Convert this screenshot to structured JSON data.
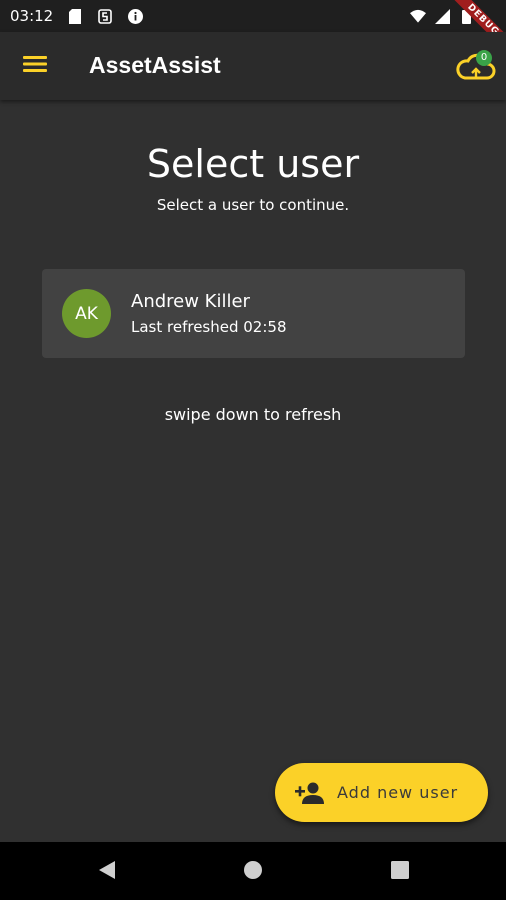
{
  "status_bar": {
    "time": "03:12",
    "icons": [
      "sd-card-icon",
      "s-notification-icon",
      "info-icon",
      "wifi-icon",
      "signal-icon",
      "battery-icon"
    ],
    "debug_banner": "DEBUG"
  },
  "app_bar": {
    "title": "AssetAssist",
    "menu_icon": "menu-icon",
    "cloud_icon": "cloud-sync-icon",
    "sync_badge_count": "0"
  },
  "page": {
    "title": "Select user",
    "subtitle": "Select a user to continue."
  },
  "users": [
    {
      "initials": "AK",
      "name": "Andrew Killer",
      "last_refreshed": "Last refreshed 02:58",
      "avatar_color": "#6e9a2d"
    }
  ],
  "refresh_hint": "swipe down to refresh",
  "fab": {
    "label": "Add new user",
    "icon": "add-person-icon"
  },
  "nav_bar": {
    "buttons": [
      "back-icon",
      "home-icon",
      "recents-icon"
    ]
  },
  "colors": {
    "background": "#303030",
    "app_bar": "#2b2b2b",
    "card": "#424242",
    "accent": "#fbd128",
    "badge": "#3aa348"
  }
}
